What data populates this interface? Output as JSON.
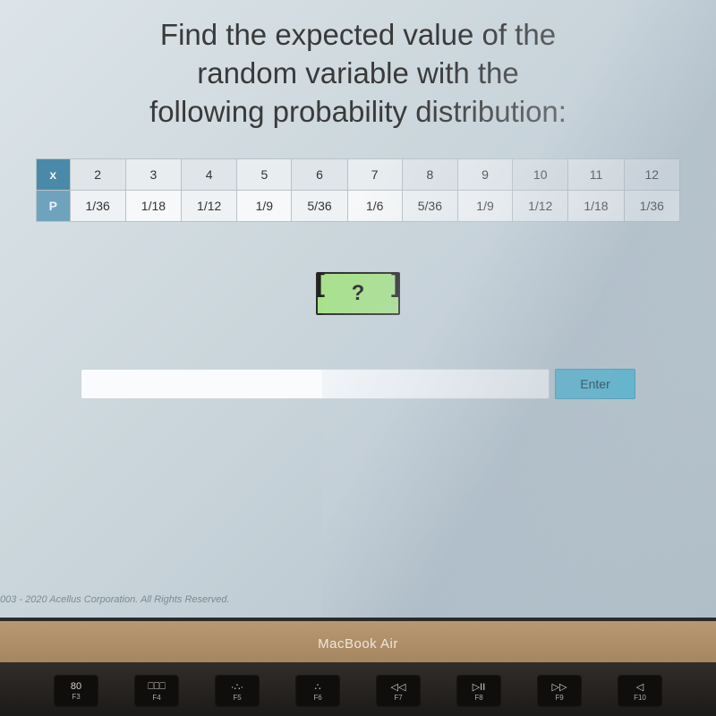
{
  "question": {
    "line1": "Find the expected value of the",
    "line2": "random variable with the",
    "line3": "following probability distribution:"
  },
  "table": {
    "x_label": "x",
    "p_label": "P",
    "x": [
      "2",
      "3",
      "4",
      "5",
      "6",
      "7",
      "8",
      "9",
      "10",
      "11",
      "12"
    ],
    "p": [
      "1/36",
      "1/18",
      "1/12",
      "1/9",
      "5/36",
      "1/6",
      "5/36",
      "1/9",
      "1/12",
      "1/18",
      "1/36"
    ]
  },
  "answer_placeholder": "?",
  "enter_label": "Enter",
  "copyright": "003 - 2020 Acellus Corporation.  All Rights Reserved.",
  "bezel": "MacBook Air",
  "keys": [
    {
      "top": "80",
      "bot": "F3"
    },
    {
      "top": "⎕⎕⎕",
      "bot": "F4"
    },
    {
      "top": "·∴·",
      "bot": "F5"
    },
    {
      "top": "∴",
      "bot": "F6"
    },
    {
      "top": "◁◁",
      "bot": "F7"
    },
    {
      "top": "▷II",
      "bot": "F8"
    },
    {
      "top": "▷▷",
      "bot": "F9"
    },
    {
      "top": "◁",
      "bot": "F10"
    }
  ]
}
